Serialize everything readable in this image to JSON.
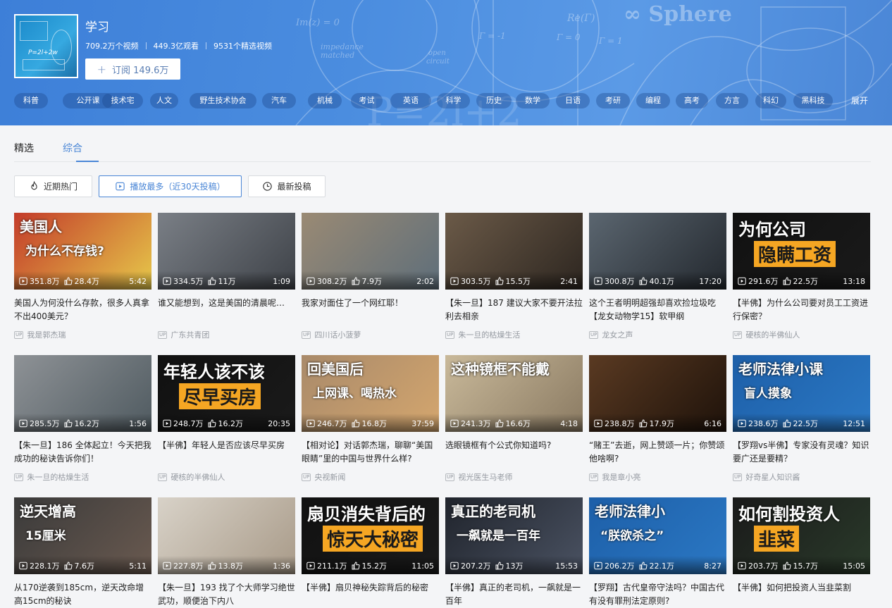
{
  "channel": {
    "title": "学习",
    "cover_text": "P=2l+2w",
    "stats": [
      "709.2万个视频",
      "449.3亿观看",
      "9531个精选视频"
    ],
    "subscribe_label": "订阅 149.6万"
  },
  "tags": [
    "科普",
    "公开课",
    "技术宅",
    "人文",
    "野生技术协会",
    "汽车",
    "机械",
    "考试",
    "英语",
    "科学",
    "历史",
    "数学",
    "日语",
    "考研",
    "编程",
    "高考",
    "方言",
    "科幻",
    "黑科技"
  ],
  "expand_label": "展开",
  "tabs": [
    "精选",
    "综合"
  ],
  "active_tab": "综合",
  "filters": [
    {
      "label": "近期热门",
      "icon": "flame-icon"
    },
    {
      "label": "播放最多（近30天投稿）",
      "icon": "play-square-icon"
    },
    {
      "label": "最新投稿",
      "icon": "clock-icon"
    }
  ],
  "active_filter": 1,
  "colors": {
    "accent": "#4a86d6",
    "banner": "#4b8ddf"
  },
  "videos": [
    {
      "title": "美国人为何没什么存款，很多人真拿不出400美元？",
      "up": "我是郭杰瑞",
      "plays": "351.8万",
      "likes": "28.4万",
      "duration": "5:42",
      "bg": "#c33b2a",
      "bg2": "#e6c84a",
      "caption": [
        "美国人",
        "为什么不存钱?"
      ]
    },
    {
      "title": "谁又能想到，这是美国的清晨呢…",
      "up": "广东共青团",
      "plays": "334.5万",
      "likes": "11万",
      "duration": "1:09",
      "bg": "#7a7f86",
      "bg2": "#3e4248",
      "caption": []
    },
    {
      "title": "我家对面住了一个网红耶！",
      "up": "四川话小菠萝",
      "plays": "308.2万",
      "likes": "7.9万",
      "duration": "2:02",
      "bg": "#9a8a74",
      "bg2": "#5e6e7a",
      "caption": []
    },
    {
      "title": "【朱一旦】187 建议大家不要开法拉利去相亲",
      "up": "朱一旦的枯燥生活",
      "plays": "303.5万",
      "likes": "15.5万",
      "duration": "2:41",
      "bg": "#6b5a48",
      "bg2": "#2d2620",
      "caption": []
    },
    {
      "title": "这个王者明明超强却喜欢捡垃圾吃【龙女动物学15】软甲纲",
      "up": "龙女之声",
      "plays": "300.8万",
      "likes": "40.1万",
      "duration": "17:20",
      "bg": "#5b6670",
      "bg2": "#23282e",
      "caption": []
    },
    {
      "title": "【半佛】为什么公司要对员工工资进行保密？",
      "up": "硬核的半佛仙人",
      "plays": "291.6万",
      "likes": "22.5万",
      "duration": "13:18",
      "bg": "#111111",
      "bg2": "#1a1a1a",
      "caption": [
        "为何公司",
        "隐瞒工资"
      ]
    },
    {
      "title": "【朱一旦】186 全体起立！今天把我成功的秘诀告诉你们！",
      "up": "朱一旦的枯燥生活",
      "plays": "285.5万",
      "likes": "16.2万",
      "duration": "1:56",
      "bg": "#8e9296",
      "bg2": "#4f5a60",
      "caption": []
    },
    {
      "title": "【半佛】年轻人是否应该尽早买房",
      "up": "硬核的半佛仙人",
      "plays": "248.7万",
      "likes": "16.2万",
      "duration": "20:35",
      "bg": "#111111",
      "bg2": "#1a1a1a",
      "caption": [
        "年轻人该不该",
        "尽早买房"
      ]
    },
    {
      "title": "【相对论】对话郭杰瑞，聊聊“美国眼睛”里的中国与世界什么样?",
      "up": "央视新闻",
      "plays": "246.7万",
      "likes": "16.8万",
      "duration": "37:59",
      "bg": "#a98a6a",
      "bg2": "#d4a66e",
      "caption": [
        "回美国后",
        "上网课、喝热水"
      ]
    },
    {
      "title": "选眼镜框有个公式你知道吗?",
      "up": "视光医生马老师",
      "plays": "241.3万",
      "likes": "16.6万",
      "duration": "4:18",
      "bg": "#c9b99a",
      "bg2": "#8a7a62",
      "caption": [
        "这种镜框不能戴"
      ]
    },
    {
      "title": "“赌王”去逝，网上赞颂一片；你赞颂他啥啊?",
      "up": "我是章小亮",
      "plays": "238.8万",
      "likes": "17.9万",
      "duration": "6:16",
      "bg": "#5a3a22",
      "bg2": "#1e120a",
      "caption": []
    },
    {
      "title": "【罗翔vs半佛】专家没有灵魂？知识要广还是要精？",
      "up": "好奇星人知识酱",
      "plays": "238.6万",
      "likes": "22.5万",
      "duration": "12:51",
      "bg": "#1d5fa8",
      "bg2": "#2b78c4",
      "caption": [
        "老师法律小课",
        "盲人摸象"
      ]
    },
    {
      "title": "从170逆袭到185cm，逆天改命增高15cm的秘诀",
      "up": "",
      "plays": "228.1万",
      "likes": "7.6万",
      "duration": "5:11",
      "bg": "#3a3a3a",
      "bg2": "#6a5a50",
      "caption": [
        "逆天增高",
        "15厘米"
      ]
    },
    {
      "title": "【朱一旦】193 找了个大师学习绝世武功，顺便治下内八",
      "up": "",
      "plays": "227.8万",
      "likes": "13.8万",
      "duration": "1:36",
      "bg": "#d8d2c8",
      "bg2": "#a89a88",
      "caption": []
    },
    {
      "title": "【半佛】扇贝神秘失踪背后的秘密",
      "up": "",
      "plays": "211.1万",
      "likes": "15.2万",
      "duration": "11:05",
      "bg": "#111111",
      "bg2": "#1a1a1a",
      "caption": [
        "扇贝消失背后的",
        "惊天大秘密"
      ]
    },
    {
      "title": "【半佛】真正的老司机，一飙就是一百年",
      "up": "",
      "plays": "207.2万",
      "likes": "13万",
      "duration": "15:53",
      "bg": "#20242c",
      "bg2": "#4a5262",
      "caption": [
        "真正的老司机",
        "一飙就是一百年"
      ]
    },
    {
      "title": "【罗翔】古代皇帝守法吗？中国古代有没有罪刑法定原则?",
      "up": "",
      "plays": "206.2万",
      "likes": "22.1万",
      "duration": "8:27",
      "bg": "#1d5fa8",
      "bg2": "#2b78c4",
      "caption": [
        "老师法律小",
        "“朕欲杀之”"
      ]
    },
    {
      "title": "【半佛】如何把投资人当韭菜割",
      "up": "",
      "plays": "203.7万",
      "likes": "15.7万",
      "duration": "15:05",
      "bg": "#1a1a1a",
      "bg2": "#2a3a2a",
      "caption": [
        "如何割投资人",
        "韭菜"
      ]
    }
  ]
}
